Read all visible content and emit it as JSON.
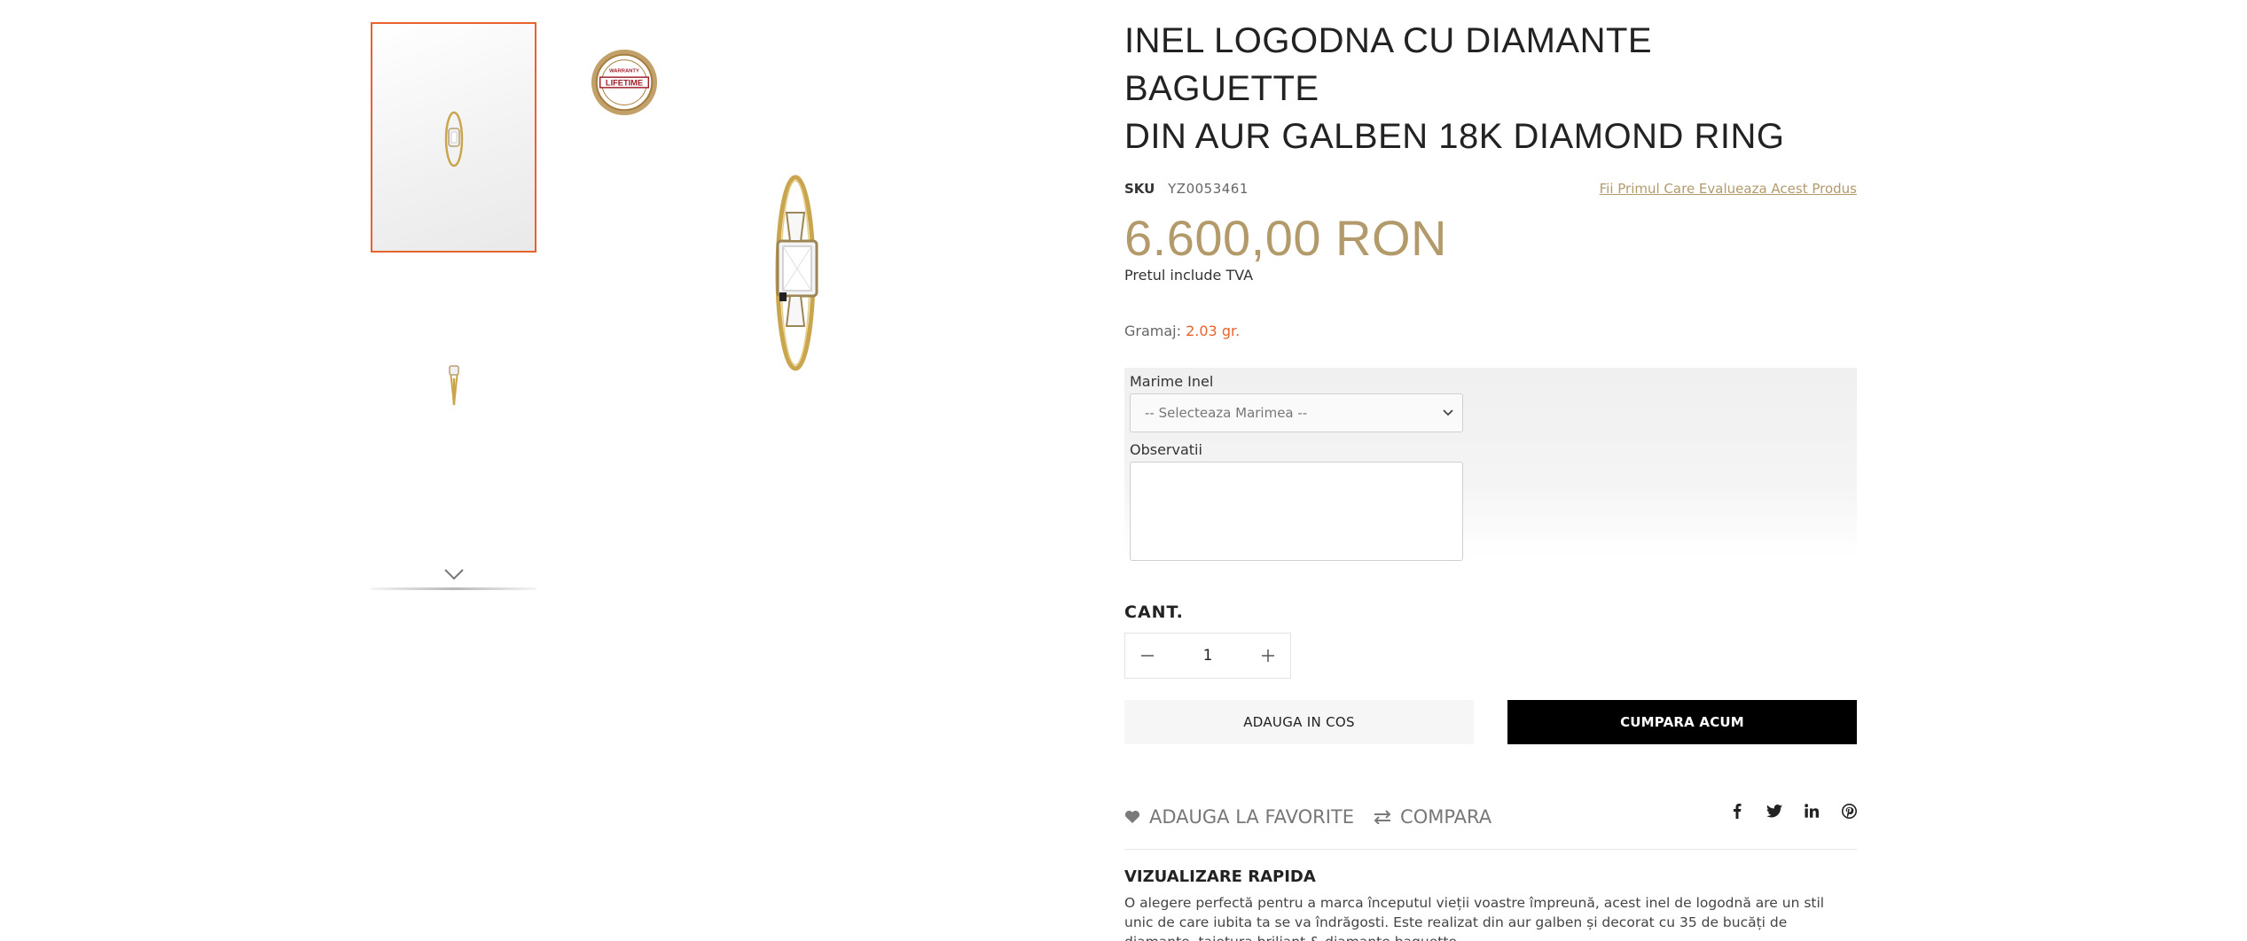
{
  "gallery": {
    "badge_text_top": "WARRANTY",
    "badge_text_mid": "LIFETIME",
    "badge_icons": [
      "lifetime-warranty-badge"
    ],
    "scroll_icon": "chevron-down-icon"
  },
  "product": {
    "title_line1": "INEL LOGODNA CU DIAMANTE BAGUETTE",
    "title_line2": "DIN AUR GALBEN 18K DIAMOND RING",
    "sku_label": "SKU",
    "sku_value": "YZ0053461",
    "review_link": "Fii Primul Care Evalueaza Acest Produs",
    "price": "6.600,00 RON",
    "vat_note": "Pretul include TVA",
    "weight_label": "Gramaj:",
    "weight_value": "2.03 gr."
  },
  "options": {
    "size_label": "Marime Inel",
    "size_selected": "-- Selecteaza Marimea --",
    "notes_label": "Observatii",
    "notes_value": ""
  },
  "quantity": {
    "label": "CANT.",
    "value": "1"
  },
  "buttons": {
    "add_to_cart": "ADAUGA IN COS",
    "buy_now": "CUMPARA ACUM"
  },
  "actions": {
    "favorite": "ADAUGA LA FAVORITE",
    "compare": "COMPARA",
    "share_icons": [
      "facebook-icon",
      "twitter-icon",
      "linkedin-icon",
      "pinterest-icon"
    ]
  },
  "quick_view": {
    "title": "VIZUALIZARE RAPIDA",
    "text": "O alegere perfectă pentru a marca începutul vieții voastre împreună, acest inel de logodnă are un stil unic de care iubita ta se va îndrăgosti. Este realizat din aur galben și decorat cu 35 de bucăți de diamante, taietura briliant & diamante baguette."
  },
  "colors": {
    "accent_gold": "#b39a6b",
    "active_border": "#e8632b",
    "weight_value": "#e8632b",
    "buy_button": "#000000"
  }
}
